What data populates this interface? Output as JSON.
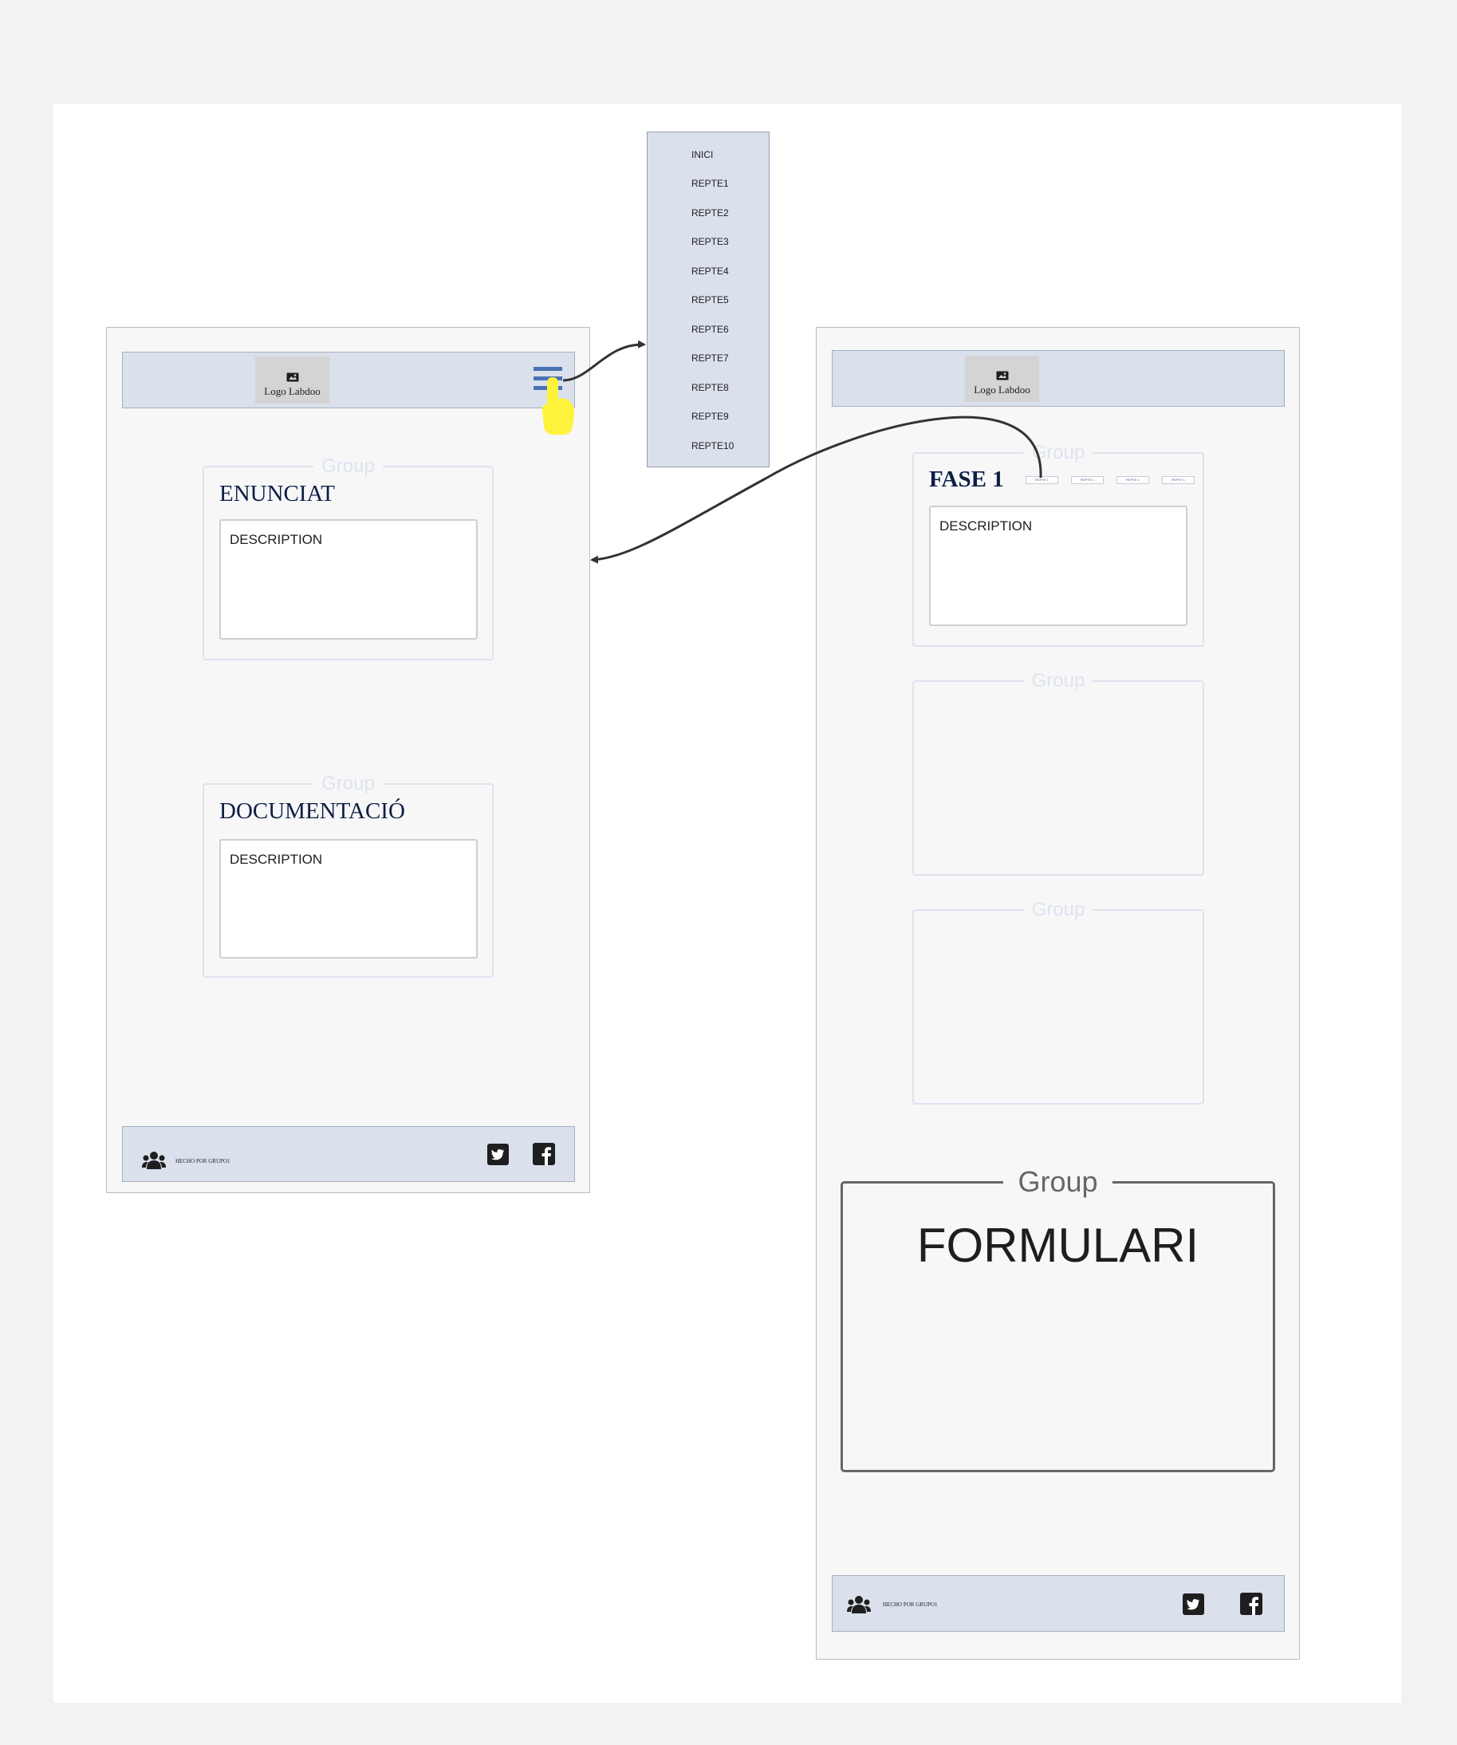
{
  "menu": {
    "items": [
      "INICI",
      "REPTE1",
      "REPTE2",
      "REPTE3",
      "REPTE4",
      "REPTE5",
      "REPTE6",
      "REPTE7",
      "REPTE8",
      "REPTE9",
      "REPTE10"
    ]
  },
  "left_screen": {
    "logo_label": "Logo Labdoo",
    "groups": [
      {
        "label": "Group",
        "title": "ENUNCIAT",
        "description": "DESCRIPTION"
      },
      {
        "label": "Group",
        "title": "DOCUMENTACIÓ",
        "description": "DESCRIPTION"
      }
    ],
    "footer_text": "HECHO POR GRUPO1"
  },
  "right_screen": {
    "logo_label": "Logo Labdoo",
    "phase_group": {
      "label": "Group",
      "title": "FASE 1",
      "tags": [
        "REPTE 1",
        "REPTE 1",
        "REPTE 1",
        "REPTE 1"
      ],
      "description": "DESCRIPTION"
    },
    "empty_groups": [
      "Group",
      "Group"
    ],
    "form_group": {
      "label": "Group",
      "title": "FORMULARI"
    },
    "footer_text": "HECHO POR GRUPO1"
  },
  "colors": {
    "bar_fill": "#dae0ec",
    "frame_fill": "#f8f7f8",
    "title_navy": "#0e1f44",
    "menu_icon_blue": "#4a74b1",
    "pointer_yellow": "#fff23b"
  },
  "icons": [
    "image-icon",
    "hamburger-menu-icon",
    "hand-pointer-icon",
    "users-icon",
    "twitter-icon",
    "facebook-icon"
  ]
}
